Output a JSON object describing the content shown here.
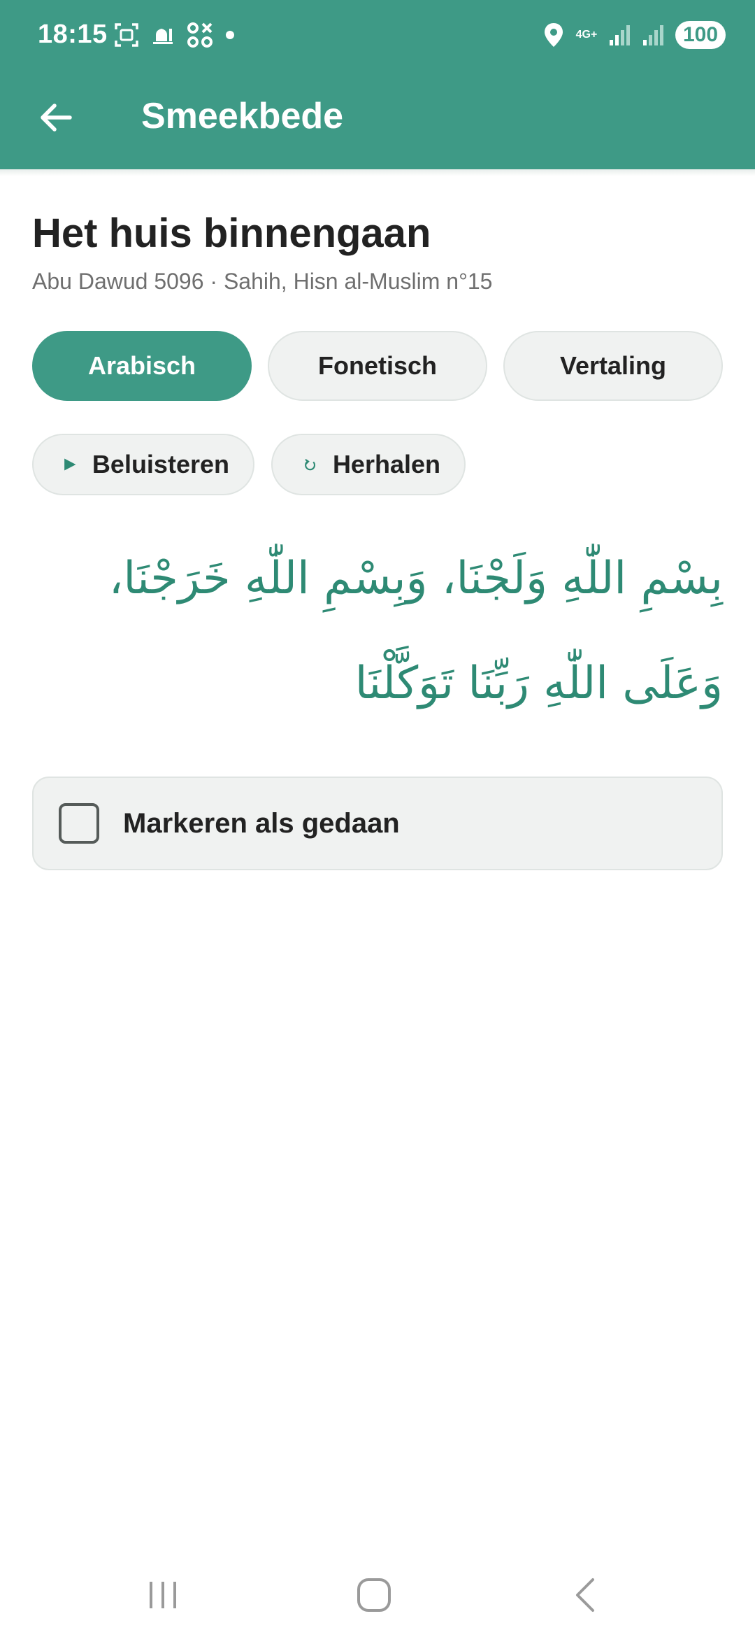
{
  "status_bar": {
    "time": "18:15",
    "network_label": "4G+",
    "battery": "100",
    "icons": [
      "screenshot-icon",
      "mosque-icon",
      "qr-icon",
      "dot-icon",
      "location-icon",
      "signal-icon",
      "signal-icon",
      "battery-icon"
    ]
  },
  "app_bar": {
    "title": "Smeekbede",
    "back_icon": "arrow-left-icon"
  },
  "dua": {
    "title": "Het huis binnengaan",
    "source": "Abu Dawud 5096 · Sahih, Hisn al-Muslim n°15",
    "arabic": "بِسْمِ اللّٰهِ وَلَجْنَا، وَبِسْمِ اللّٰهِ خَرَجْنَا، وَعَلَى اللّٰهِ رَبِّنَا تَوَكَّلْنَا"
  },
  "tabs": [
    {
      "label": "Arabisch",
      "active": true
    },
    {
      "label": "Fonetisch",
      "active": false
    },
    {
      "label": "Vertaling",
      "active": false
    }
  ],
  "actions": {
    "play_label": "Beluisteren",
    "repeat_label": "Herhalen"
  },
  "done": {
    "label": "Markeren als gedaan",
    "checked": false
  },
  "colors": {
    "primary": "#3e9a86",
    "arabic_text": "#2e8a74",
    "chip_bg": "#f0f2f1"
  },
  "nav_bar": [
    "recents-icon",
    "home-icon",
    "back-icon"
  ]
}
